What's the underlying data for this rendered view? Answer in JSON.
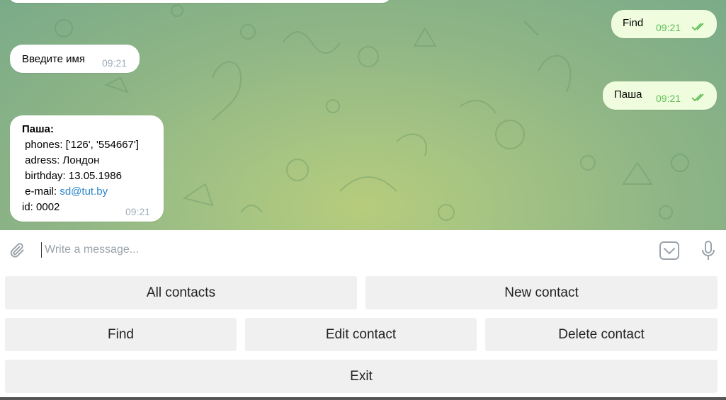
{
  "messages": {
    "out_find": {
      "text": "Find",
      "time": "09:21"
    },
    "in_prompt": {
      "text": "Введите имя",
      "time": "09:21"
    },
    "out_name": {
      "text": "Паша",
      "time": "09:21"
    },
    "contact_card": {
      "title": "Паша:",
      "phones": " phones: ['126', '554667']",
      "adress": " adress: Лондон",
      "birthday": " birthday: 13.05.1986",
      "email_label": " e-mail: ",
      "email_link": "sd@tut.by",
      "id": "id: 0002",
      "time": "09:21"
    }
  },
  "input": {
    "placeholder": "Write a message..."
  },
  "icons": {
    "attach": "paperclip-icon",
    "bot_keyboard": "keyboard-toggle-icon",
    "voice": "microphone-icon"
  },
  "keyboard": {
    "all_contacts": "All contacts",
    "new_contact": "New contact",
    "find": "Find",
    "edit_contact": "Edit contact",
    "delete_contact": "Delete contact",
    "exit": "Exit"
  },
  "colors": {
    "outgoing_bubble": "#effdde",
    "incoming_bubble": "#ffffff",
    "read_check": "#5fbd57",
    "link": "#2a85c9",
    "button_bg": "#f0f0f0"
  }
}
